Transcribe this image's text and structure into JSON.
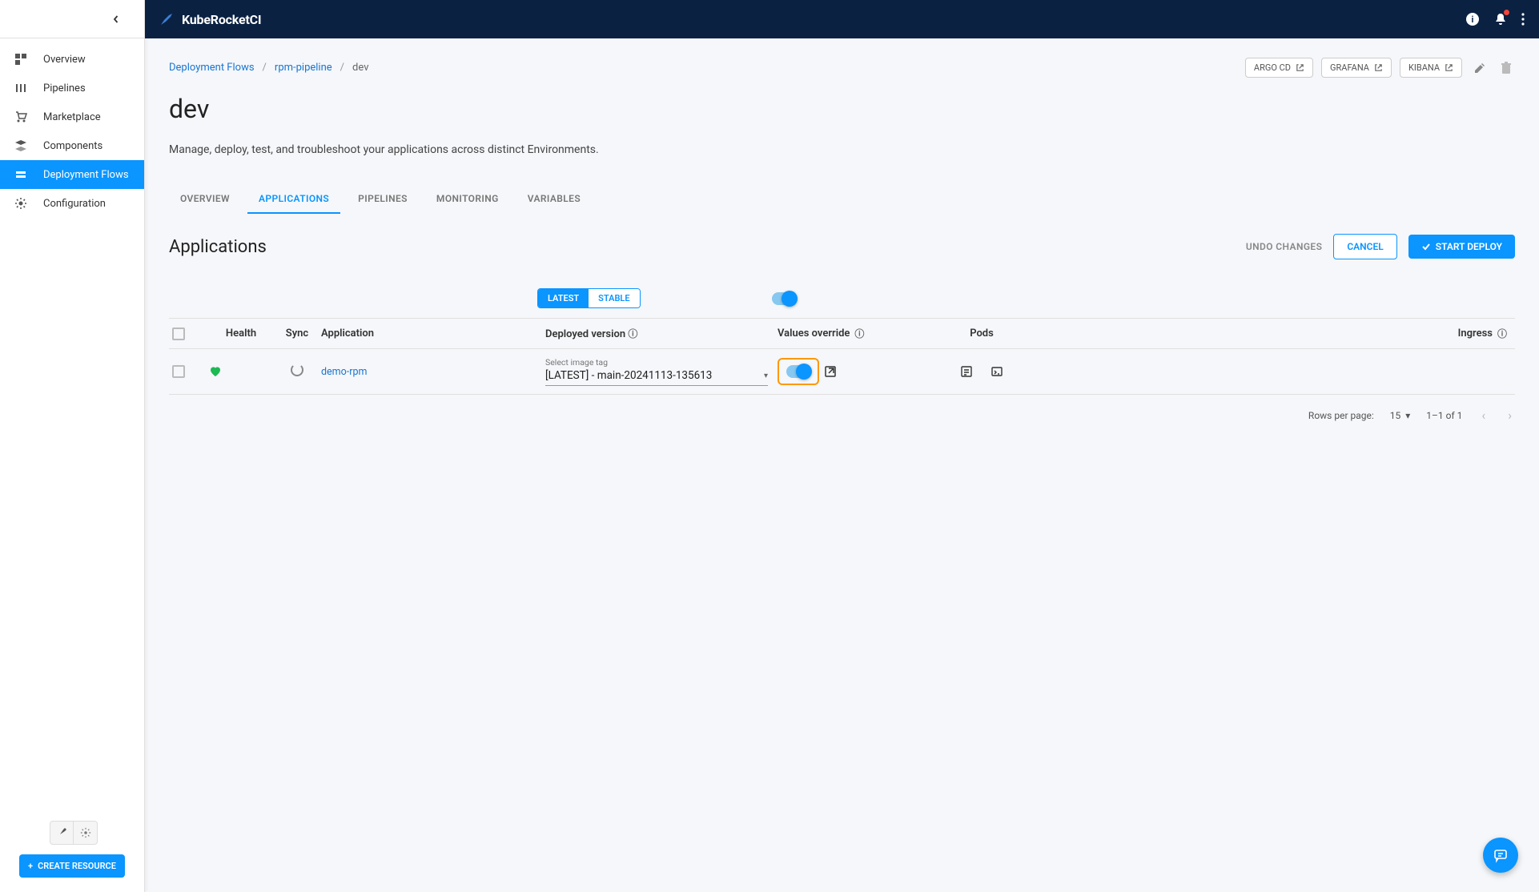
{
  "brand": {
    "name": "KubeRocketCI"
  },
  "sidebar": {
    "items": [
      {
        "label": "Overview"
      },
      {
        "label": "Pipelines"
      },
      {
        "label": "Marketplace"
      },
      {
        "label": "Components"
      },
      {
        "label": "Deployment Flows"
      },
      {
        "label": "Configuration"
      }
    ],
    "create_button": "CREATE RESOURCE"
  },
  "breadcrumb": {
    "root": "Deployment Flows",
    "pipeline": "rpm-pipeline",
    "current": "dev"
  },
  "top_links": {
    "argocd": "ARGO CD",
    "grafana": "GRAFANA",
    "kibana": "KIBANA"
  },
  "page": {
    "title": "dev",
    "description": "Manage, deploy, test, and troubleshoot your applications across distinct Environments."
  },
  "tabs": [
    {
      "label": "OVERVIEW"
    },
    {
      "label": "APPLICATIONS"
    },
    {
      "label": "PIPELINES"
    },
    {
      "label": "MONITORING"
    },
    {
      "label": "VARIABLES"
    }
  ],
  "section": {
    "title": "Applications",
    "undo": "UNDO CHANGES",
    "cancel": "CANCEL",
    "start_deploy": "START DEPLOY"
  },
  "filters": {
    "latest": "LATEST",
    "stable": "STABLE"
  },
  "table": {
    "headers": {
      "health": "Health",
      "sync": "Sync",
      "application": "Application",
      "deployed_version": "Deployed version",
      "values_override": "Values override",
      "pods": "Pods",
      "ingress": "Ingress"
    },
    "rows": [
      {
        "app_name": "demo-rpm",
        "image_tag_label": "Select image tag",
        "image_tag_value": "[LATEST] - main-20241113-135613"
      }
    ]
  },
  "pagination": {
    "rows_per_page_label": "Rows per page:",
    "rows_per_page_value": "15",
    "range": "1–1 of 1"
  }
}
